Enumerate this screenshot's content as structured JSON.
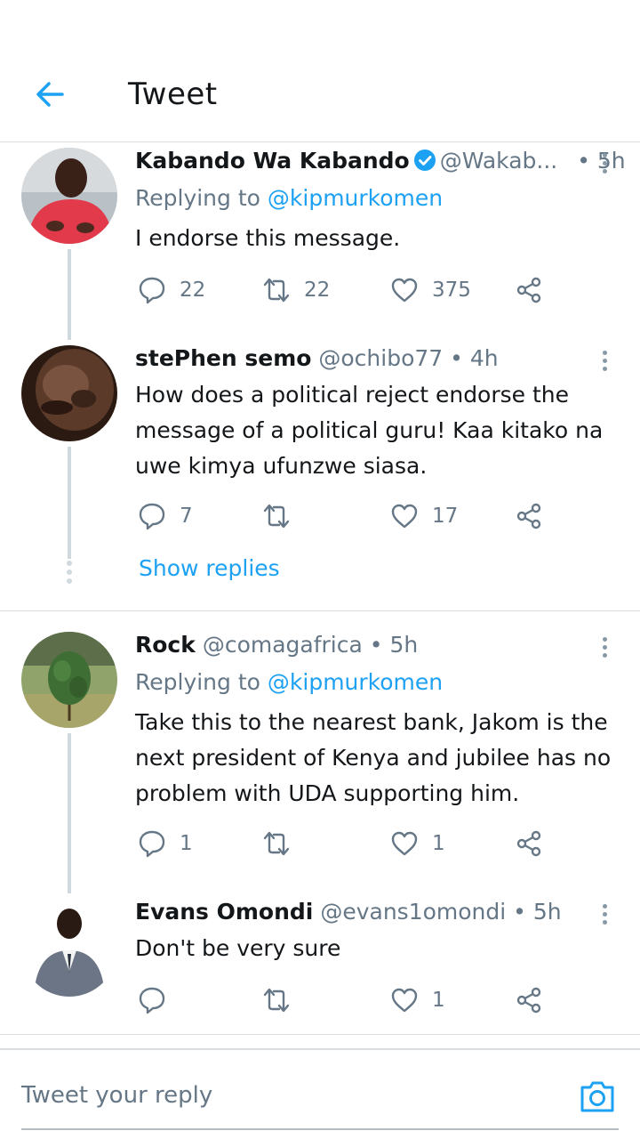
{
  "header": {
    "title": "Tweet"
  },
  "tweets": [
    {
      "name": "Kabando Wa Kabando",
      "handle": "@Wakab...",
      "time": "• 5h",
      "replying_prefix": "Replying to",
      "replying_to": "@kipmurkomen",
      "body": "I endorse this message.",
      "replies": "22",
      "retweets": "22",
      "likes": "375"
    },
    {
      "name": "stePhen semo",
      "handle": "@ochibo77",
      "time": "• 4h",
      "body": "How does a political reject endorse the message of a political guru! Kaa kitako na uwe kimya ufunzwe siasa.",
      "replies": "7",
      "retweets": "",
      "likes": "17"
    },
    {
      "name": "Rock",
      "handle": "@comagafrica",
      "time": "• 5h",
      "replying_prefix": "Replying to",
      "replying_to": "@kipmurkomen",
      "body": "Take this to the nearest bank, Jakom is the next president of Kenya and jubilee has no problem with UDA supporting him.",
      "replies": "1",
      "retweets": "",
      "likes": "1"
    },
    {
      "name": "Evans Omondi",
      "handle": "@evans1omondi",
      "time": "• 5h",
      "body": "Don't be very sure",
      "replies": "",
      "retweets": "",
      "likes": "1"
    }
  ],
  "show_replies": "Show replies",
  "reply_bar": {
    "placeholder": "Tweet your reply"
  },
  "colors": {
    "accent": "#1da1f2",
    "muted": "#657786",
    "divider": "#d9dee2"
  }
}
